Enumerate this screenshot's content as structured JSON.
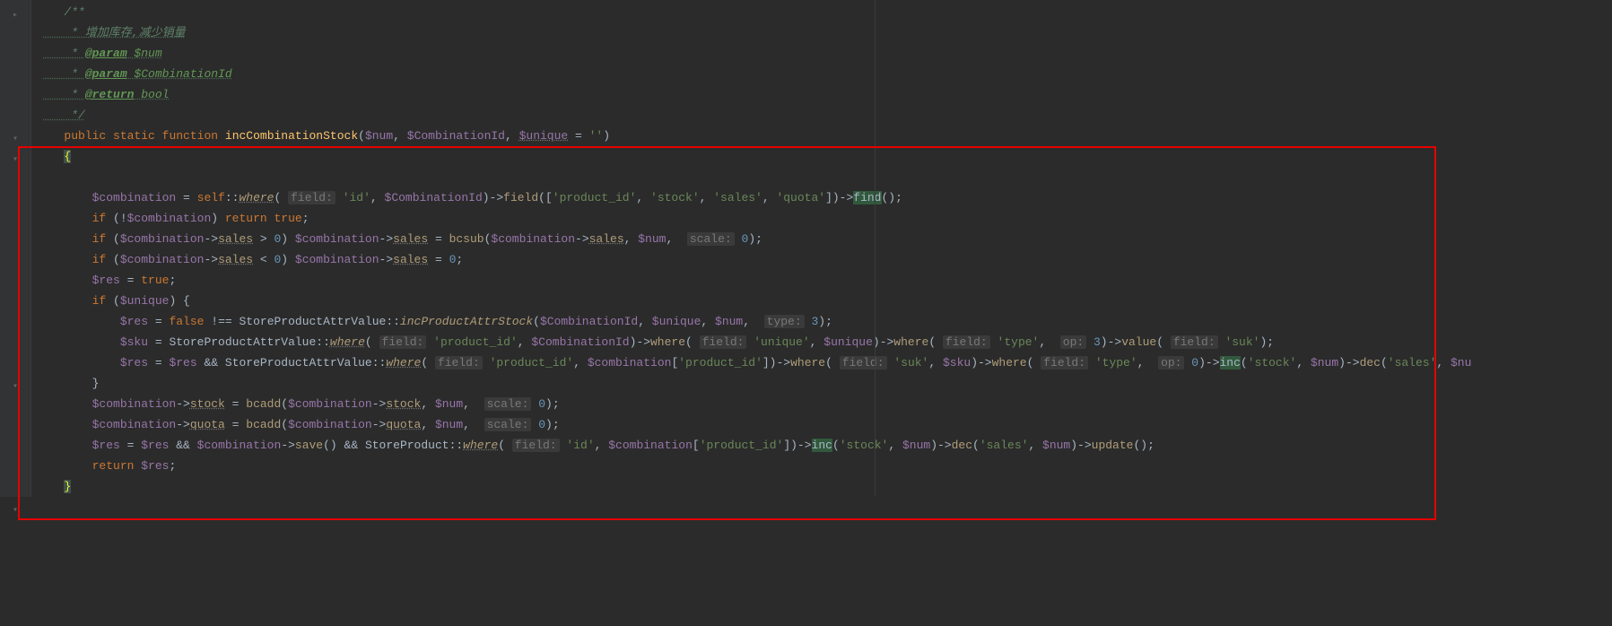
{
  "code": {
    "doc1": "/**",
    "doc2": " * 增加库存,减少销量",
    "doc3": " * ",
    "doc3tag": "@param",
    "doc3var": " $num",
    "doc4": " * ",
    "doc4tag": "@param",
    "doc4var": " $CombinationId",
    "doc5": " * ",
    "doc5tag": "@return",
    "doc5var": " bool",
    "doc6": " */",
    "sig_public": "public",
    "sig_static": "static",
    "sig_function": "function",
    "sig_name": "incCombinationStock",
    "sig_params_open": "(",
    "sig_p1": "$num",
    "sig_p2": "$CombinationId",
    "sig_p3": "$unique",
    "sig_eq": " = ",
    "sig_default": "''",
    "sig_params_close": ")",
    "brace_open": "{",
    "l1_v": "$combination",
    "l1_txt1": " = ",
    "l1_self": "self",
    "l1_w": "where",
    "l1_hint1": "field:",
    "l1_s1": "'id'",
    "l1_v2": "$CombinationId",
    "l1_field": "field",
    "l1_arr": "(['product_id', 'stock', 'sales', 'quota'])",
    "l1_s2": "'product_id'",
    "l1_s3": "'stock'",
    "l1_s4": "'sales'",
    "l1_s5": "'quota'",
    "l1_find": "find",
    "l2_if": "if",
    "l2_not": "!",
    "l2_v": "$combination",
    "l2_ret": "return",
    "l2_true": "true",
    "l3_if": "if",
    "l3_v": "$combination",
    "l3_sales": "sales",
    "l3_gt": " > ",
    "l3_0": "0",
    "l3_bcsub": "bcsub",
    "l3_num": "$num",
    "l3_hint": "scale:",
    "l4_lt": " < ",
    "l5_res": "$res",
    "l5_true": "true",
    "l6_unique": "$unique",
    "l7_false": "false",
    "l7_neq": " !== ",
    "l7_cls": "StoreProductAttrValue",
    "l7_fn": "incProductAttrStock",
    "l7_hint": "type:",
    "l7_3": "3",
    "l8_sku": "$sku",
    "l8_pid": "'product_id'",
    "l8_unique_s": "'unique'",
    "l8_type_s": "'type'",
    "l8_op": "op:",
    "l8_value": "value",
    "l8_suk": "'suk'",
    "l9_and": " && ",
    "l9_suk_s": "'suk'",
    "l9_inc": "inc",
    "l9_stock": "'stock'",
    "l9_dec": "dec",
    "l9_sales_s": "'sales'",
    "l10_stock": "stock",
    "l10_bcadd": "bcadd",
    "l11_quota": "quota",
    "l12_save": "save",
    "l12_cls": "StoreProduct",
    "l12_update": "update",
    "l13_ret": "return",
    "l13_res": "$res",
    "brace_close": "}"
  }
}
